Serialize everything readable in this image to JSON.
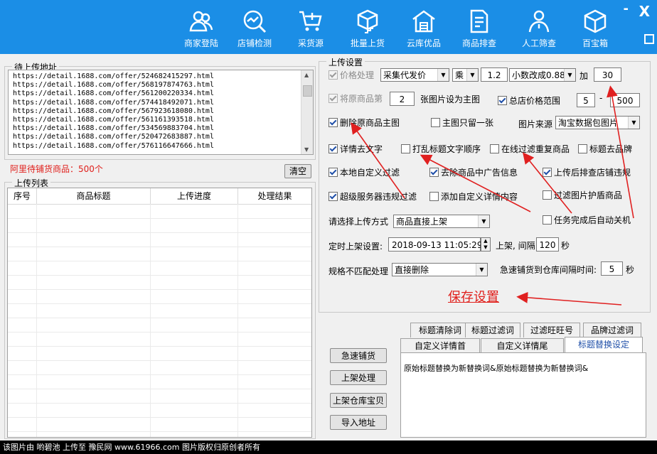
{
  "toolbar": {
    "items": [
      {
        "label": "商家登陆",
        "icon": "users-icon"
      },
      {
        "label": "店铺检测",
        "icon": "chart-search-icon"
      },
      {
        "label": "采货源",
        "icon": "cart-plus-icon"
      },
      {
        "label": "批量上货",
        "icon": "box-stairs-icon"
      },
      {
        "label": "云库优品",
        "icon": "warehouse-icon"
      },
      {
        "label": "商品排查",
        "icon": "document-check-icon"
      },
      {
        "label": "人工筛查",
        "icon": "person-icon"
      },
      {
        "label": "百宝箱",
        "icon": "cube-icon"
      }
    ],
    "close": "X",
    "minimize": "-"
  },
  "pending": {
    "title": "待上传地址",
    "urls": [
      "https://detail.1688.com/offer/524682415297.html",
      "https://detail.1688.com/offer/568197874763.html",
      "https://detail.1688.com/offer/561200220334.html",
      "https://detail.1688.com/offer/574418492071.html",
      "https://detail.1688.com/offer/567923618080.html",
      "https://detail.1688.com/offer/561161393518.html",
      "https://detail.1688.com/offer/534569883704.html",
      "https://detail.1688.com/offer/520472683887.html",
      "https://detail.1688.com/offer/576116647666.html"
    ],
    "count_label": "阿里待铺货商品：500个",
    "clear_button": "清空"
  },
  "upload_list": {
    "title": "上传列表",
    "columns": [
      "序号",
      "商品标题",
      "上传进度",
      "处理结果"
    ]
  },
  "settings": {
    "title": "上传设置",
    "price_label": "价格处理",
    "price_mode": "采集代发价",
    "operator": "乘",
    "multiplier": "1.2",
    "decimal_mode": "小数改成0.88",
    "add_label": "加",
    "add_value": "30",
    "orig_image_prefix": "将原商品第",
    "orig_image_index": "2",
    "orig_image_suffix": "张图片设为主图",
    "price_range_label": "总店价格范围",
    "price_min": "5",
    "price_dash": "-",
    "price_max": "500",
    "del_main_image": "删除原商品主图",
    "keep_one_main": "主图只留一张",
    "image_source_label": "图片来源",
    "image_source": "淘宝数据包图片",
    "detail_remove_text": "详情去文字",
    "shuffle_title": "打乱标题文字顺序",
    "online_dedupe": "在线过滤重复商品",
    "title_remove_brand": "标题去品牌",
    "local_filter": "本地自定义过滤",
    "remove_ads": "去除商品中广告信息",
    "check_violation": "上传后排查店铺违规",
    "service_filter": "超级服务器违规过滤",
    "add_custom_detail": "添加自定义详情内容",
    "filter_shield_images": "过滤图片护盾商品",
    "upload_mode_label": "请选择上传方式",
    "upload_mode": "商品直接上架",
    "auto_shutdown": "任务完成后自动关机",
    "schedule_label": "定时上架设置:",
    "schedule_time": "2018-09-13 11:05:29",
    "interval_label": "上架, 间隔",
    "interval_value": "120",
    "seconds": "秒",
    "spec_label": "规格不匹配处理",
    "spec_mode": "直接删除",
    "quick_interval_label": "急速铺货到仓库间隔时间:",
    "quick_interval_value": "5",
    "quick_seconds": "秒",
    "save": "保存设置"
  },
  "actions": {
    "quick_list": "急速铺货",
    "list_process": "上架处理",
    "list_warehouse": "上架仓库宝贝",
    "import_address": "导入地址"
  },
  "tabs": {
    "row1": [
      "标题清除词",
      "标题过滤词",
      "过滤旺旺号",
      "品牌过滤词"
    ],
    "row2": [
      "自定义详情首",
      "自定义详情尾",
      "标题替换设定"
    ],
    "active": "标题替换设定",
    "content": "原始标题替换为新替换词&原始标题替换为新替换词&"
  },
  "watermark": "该图片由 哟碧池 上传至 豫民网 www.61966.com 图片版权归原创者所有",
  "colors": {
    "topbar": "#1b8ee6",
    "accent_red": "#e0201c",
    "arrow_red": "#e02020"
  }
}
